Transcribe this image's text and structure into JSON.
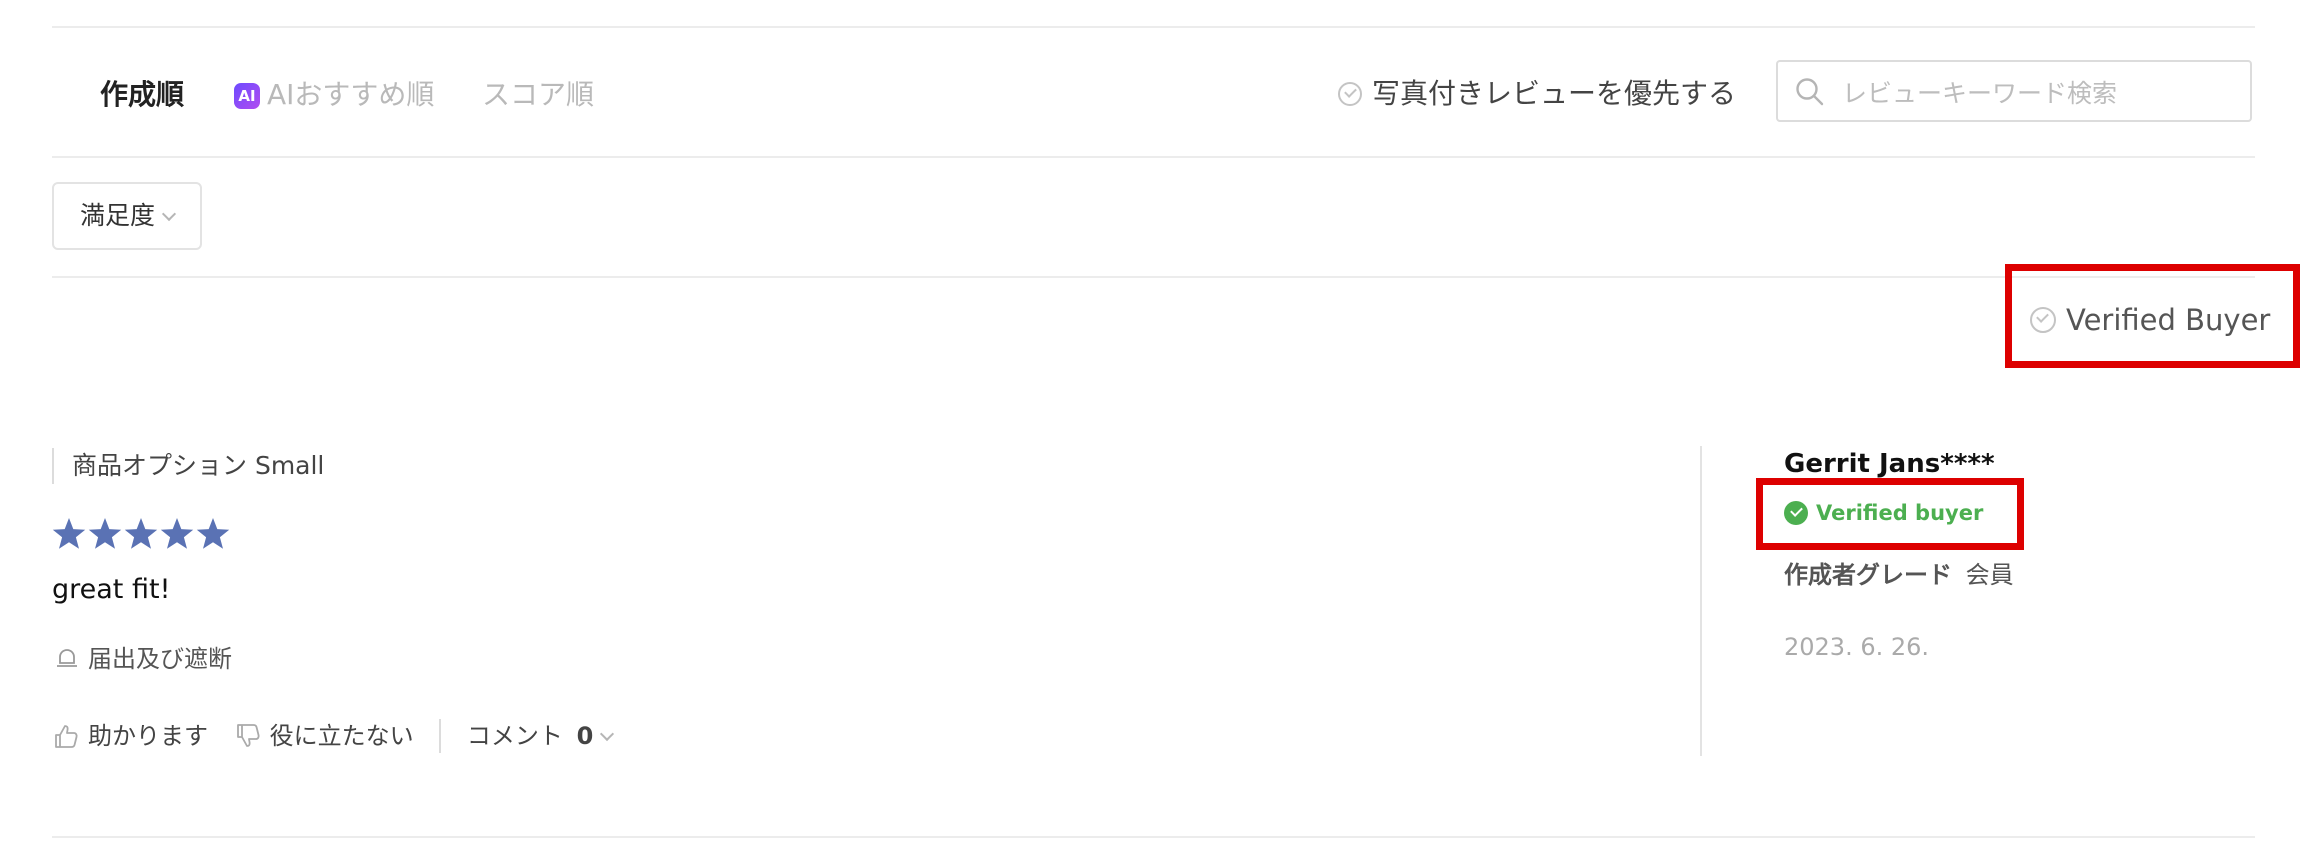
{
  "sort_tabs": [
    {
      "label": "作成順",
      "active": true
    },
    {
      "label": "AIおすすめ順",
      "active": false,
      "badge": "AI"
    },
    {
      "label": "スコア順",
      "active": false
    }
  ],
  "photo_priority_label": "写真付きレビューを優先する",
  "search": {
    "placeholder": "レビューキーワード検索",
    "value": ""
  },
  "filter": {
    "satisfaction_label": "満足度"
  },
  "verified_buyer_filter_label": "Verified Buyer",
  "review": {
    "option_label": "商品オプション Small",
    "rating": 5,
    "rating_max": 5,
    "text": "great fit!",
    "report_label": "届出及び遮断",
    "helpful_label": "助かります",
    "not_helpful_label": "役に立たない",
    "comment_label": "コメント",
    "comment_count": "0",
    "author": "Gerrit Jans****",
    "verified_badge": "Verified buyer",
    "grade_label": "作成者グレード",
    "grade_value": "会員",
    "date": "2023. 6. 26."
  },
  "colors": {
    "highlight": "#dd0000",
    "star": "#5a72b4",
    "verified_green": "#4caf50",
    "ai_badge": "#7a4cf5"
  }
}
